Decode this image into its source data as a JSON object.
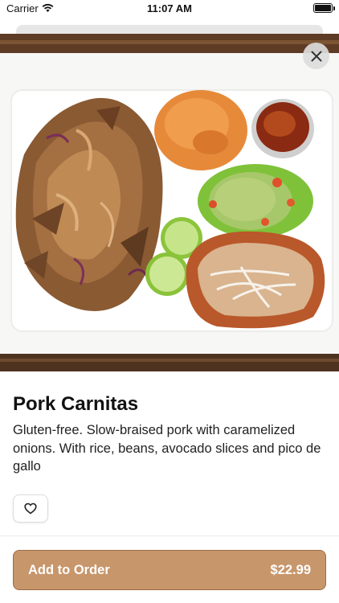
{
  "status_bar": {
    "carrier": "Carrier",
    "time": "11:07 AM"
  },
  "hero": {
    "icon": "close-icon"
  },
  "item": {
    "title": "Pork Carnitas",
    "description": "Gluten-free. Slow-braised pork with caramelized onions. With rice, beans, avocado slices and pico de gallo"
  },
  "actions": {
    "favorite_icon": "heart-outline-icon",
    "add_label": "Add to Order",
    "price": "$22.99"
  },
  "colors": {
    "button_bg": "#c8966b",
    "button_border": "#9c6b44"
  }
}
